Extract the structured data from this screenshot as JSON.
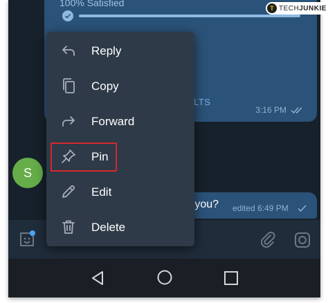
{
  "chat": {
    "poll_header": "100% Satisfied",
    "results_label": "LTS",
    "message1_time": "3:16 PM",
    "avatar_initial": "S",
    "message2_text": "e you?",
    "message2_edited": "edited 6:49 PM"
  },
  "context_menu": {
    "items": [
      {
        "label": "Reply",
        "icon": "reply-icon"
      },
      {
        "label": "Copy",
        "icon": "copy-icon"
      },
      {
        "label": "Forward",
        "icon": "forward-icon"
      },
      {
        "label": "Pin",
        "icon": "pin-icon"
      },
      {
        "label": "Edit",
        "icon": "edit-icon"
      },
      {
        "label": "Delete",
        "icon": "delete-icon"
      }
    ],
    "highlighted": "Pin"
  },
  "input_bar": {
    "icons": [
      "sticker-icon",
      "attach-icon",
      "camera-icon"
    ]
  },
  "nav_bar": {
    "icons": [
      "back-icon",
      "home-icon",
      "recents-icon"
    ]
  },
  "watermark": {
    "logo_letter": "T",
    "brand_light": "TECH",
    "brand_bold": "JUNKIE"
  },
  "colors": {
    "chat_background": "#17212b",
    "outgoing_bubble": "#2b5278",
    "menu_background": "#2e3a48",
    "highlight_border": "#d42a2a",
    "avatar": "#66ad49"
  }
}
